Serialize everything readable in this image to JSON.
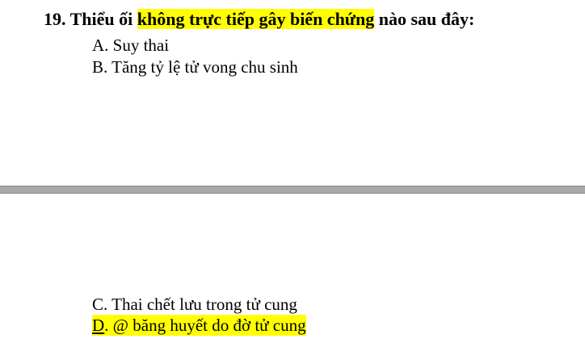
{
  "question": {
    "number": "19.",
    "text_before": "Thiểu ối",
    "text_highlighted": "không trực tiếp gây biến chứng",
    "text_after": "nào sau đây:"
  },
  "options": {
    "a": "A. Suy thai",
    "b": "B. Tăng tỷ lệ tử vong chu sinh",
    "c": "C. Thai chết lưu trong tử cung",
    "d_letter": "D",
    "d_text": ". @ băng huyết do đờ tử cung"
  },
  "colors": {
    "highlight": "#ffff00",
    "page_break": "#a9a9a9"
  }
}
